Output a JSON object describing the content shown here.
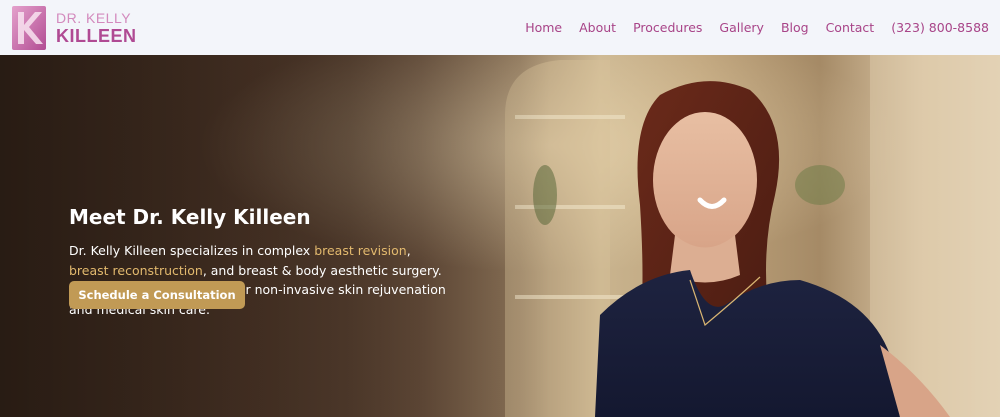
{
  "logo": {
    "line1": "DR. KELLY",
    "line2": "KILLEEN",
    "icon": "kk-monogram-icon",
    "colors": {
      "light": "#d38abd",
      "dark": "#b04a93"
    }
  },
  "nav": {
    "items": [
      {
        "label": "Home"
      },
      {
        "label": "About"
      },
      {
        "label": "Procedures"
      },
      {
        "label": "Gallery"
      },
      {
        "label": "Blog"
      },
      {
        "label": "Contact"
      }
    ],
    "phone": "(323) 800-8588",
    "color": "#a84488"
  },
  "hero": {
    "title": "Meet Dr. Kelly Killeen",
    "desc_part1": "Dr. Kelly Killeen specializes in complex ",
    "link1": "breast revision",
    "desc_part2": ",",
    "link2": "breast reconstruction",
    "desc_part3": ", and breast & body aesthetic surgery. She has a special passion for non-invasive skin rejuvenation and medical skin care.",
    "cta_label": "Schedule a Consultation",
    "accent": "#c19a55",
    "link_color": "#e2b96e"
  }
}
